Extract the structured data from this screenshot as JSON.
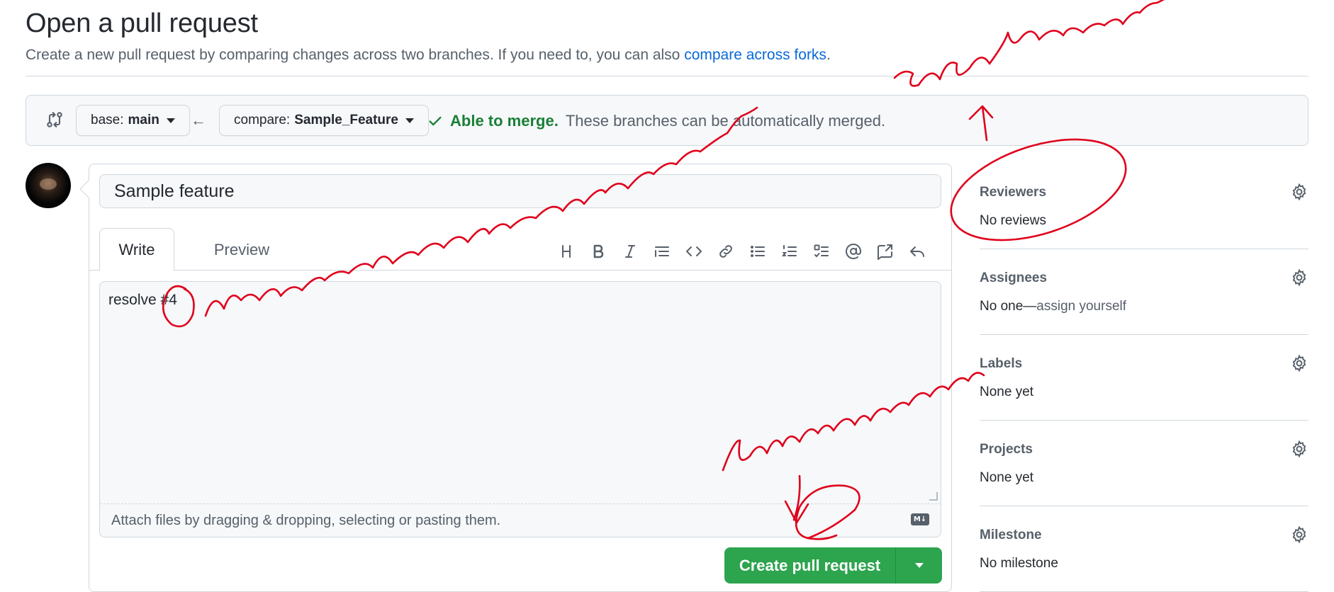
{
  "header": {
    "title": "Open a pull request",
    "subtitle_prefix": "Create a new pull request by comparing changes across two branches. If you need to, you can also ",
    "subtitle_link": "compare across forks",
    "subtitle_suffix": "."
  },
  "range": {
    "base_label": "base:",
    "base_value": "main",
    "compare_label": "compare:",
    "compare_value": "Sample_Feature",
    "merge_status": "Able to merge.",
    "merge_detail": "These branches can be automatically merged."
  },
  "composer": {
    "title_value": "Sample feature",
    "tabs": [
      "Write",
      "Preview"
    ],
    "toolbar_icons": [
      "heading-icon",
      "bold-icon",
      "italic-icon",
      "quote-icon",
      "code-icon",
      "link-icon",
      "bulleted-list-icon",
      "numbered-list-icon",
      "task-list-icon",
      "mention-icon",
      "cross-reference-icon",
      "reply-icon"
    ],
    "body_text": "resolve #4",
    "attach_hint": "Attach files by dragging & dropping, selecting or pasting them.",
    "markdown_badge": "M↓",
    "create_label": "Create pull request"
  },
  "sidebar": {
    "sections": [
      {
        "heading": "Reviewers",
        "value": "No reviews",
        "value_muted": ""
      },
      {
        "heading": "Assignees",
        "value": "No one—",
        "value_muted": "assign yourself"
      },
      {
        "heading": "Labels",
        "value": "None yet",
        "value_muted": ""
      },
      {
        "heading": "Projects",
        "value": "None yet",
        "value_muted": ""
      },
      {
        "heading": "Milestone",
        "value": "No milestone",
        "value_muted": ""
      }
    ]
  },
  "colors": {
    "accent_link": "#0969da",
    "success": "#1a7f37",
    "primary_button": "#2da44e",
    "annotation_ink": "#e0001b"
  }
}
